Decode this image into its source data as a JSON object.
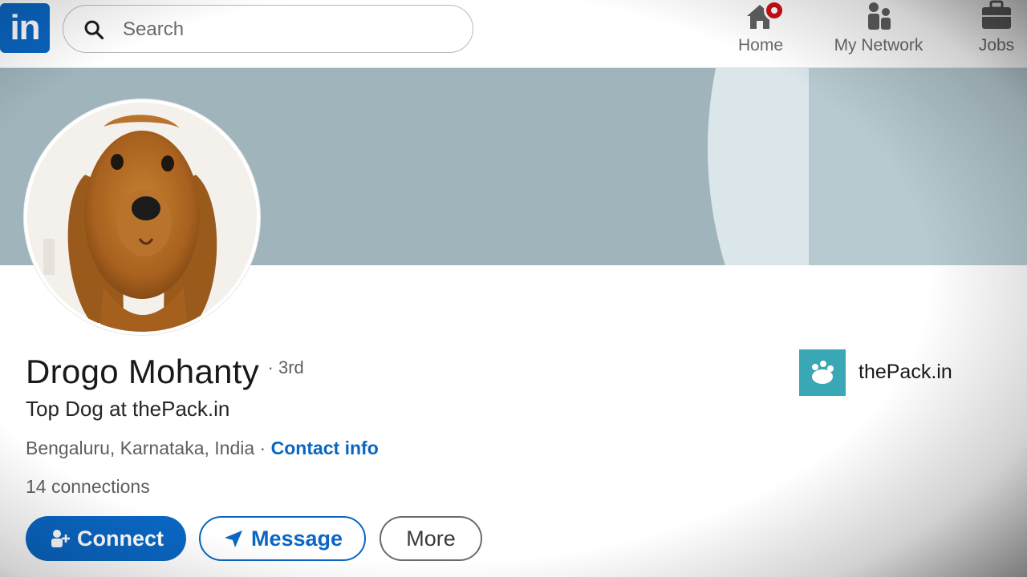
{
  "nav": {
    "logo_text": "in",
    "search_placeholder": "Search",
    "items": [
      {
        "label": "Home",
        "icon": "home-icon"
      },
      {
        "label": "My Network",
        "icon": "people-icon"
      },
      {
        "label": "Jobs",
        "icon": "briefcase-icon"
      }
    ]
  },
  "profile": {
    "name": "Drogo Mohanty",
    "degree": "· 3rd",
    "headline": "Top Dog at thePack.in",
    "location": "Bengaluru, Karnataka, India",
    "separator": " · ",
    "contact_link": "Contact info",
    "connections": "14 connections"
  },
  "company": {
    "name": "thePack.in"
  },
  "actions": {
    "connect": "Connect",
    "message": "Message",
    "more": "More"
  },
  "colors": {
    "brand": "#0a66c2",
    "banner": "#9fb4bb",
    "company_logo": "#3aa7b5",
    "notification": "#cc1016"
  }
}
